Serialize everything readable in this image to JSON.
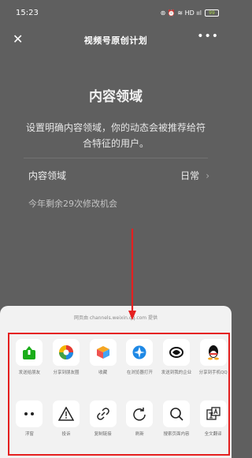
{
  "status": {
    "time": "15:23",
    "icons": "⊛ ⏰ ≋ HD ııl",
    "battery": "99"
  },
  "nav": {
    "close": "✕",
    "title": "视频号原创计划",
    "more": "•••"
  },
  "content": {
    "title": "内容领域",
    "desc": "设置明确内容领域，你的动态会被推荐给符合特征的用户。",
    "field_label": "内容领域",
    "field_value": "日常",
    "chevron": "›",
    "remaining": "今年剩余29次修改机会"
  },
  "sheet": {
    "source": "网页由 channels.weixin.qq.com 提供",
    "row1": [
      {
        "label": "发送给朋友",
        "icon": "share-to-friend-icon"
      },
      {
        "label": "分享到朋友圈",
        "icon": "moments-icon"
      },
      {
        "label": "收藏",
        "icon": "favorite-icon"
      },
      {
        "label": "在浏览器打开",
        "icon": "browser-icon"
      },
      {
        "label": "发送到我的企业",
        "icon": "wecom-icon"
      },
      {
        "label": "分享到手机QQ",
        "icon": "qq-icon"
      }
    ],
    "row2": [
      {
        "label": "浮窗",
        "icon": "float-window-icon"
      },
      {
        "label": "投诉",
        "icon": "warning-icon"
      },
      {
        "label": "复制链接",
        "icon": "link-icon"
      },
      {
        "label": "刷新",
        "icon": "refresh-icon"
      },
      {
        "label": "搜索页面内容",
        "icon": "search-icon"
      },
      {
        "label": "全文翻译",
        "icon": "translate-icon"
      }
    ]
  },
  "colors": {
    "highlight": "#e52020",
    "sheet_bg": "#f2f2f2",
    "overlay": "#5f5f5f"
  }
}
